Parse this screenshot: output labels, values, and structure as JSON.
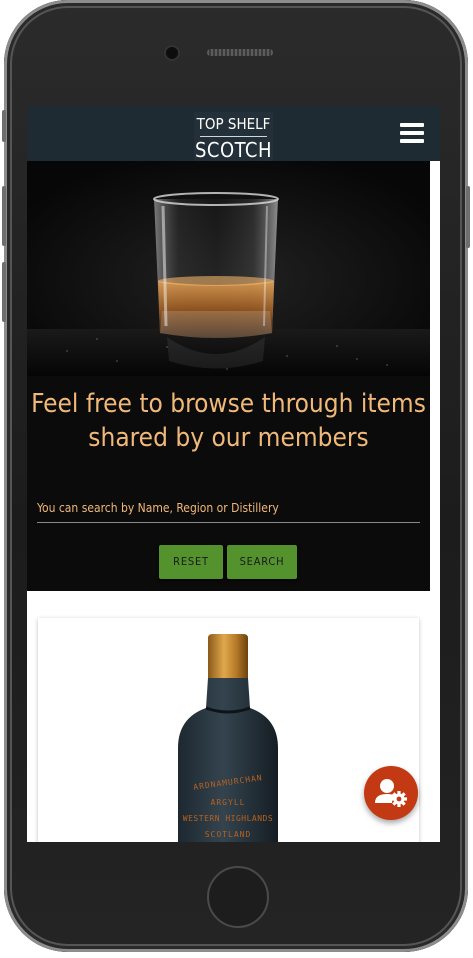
{
  "navbar": {
    "logo_line1": "TOP SHELF",
    "logo_line2": "SCOTCH",
    "menu_icon": "hamburger-menu-icon"
  },
  "hero": {
    "title": "Feel free to browse through items shared by our members",
    "image": "whisky-glass-photo"
  },
  "search": {
    "placeholder": "You can search by Name, Region or Distillery",
    "reset_label": "RESET",
    "search_label": "SEARCH"
  },
  "product_card": {
    "image": "whisky-bottle-photo",
    "label_line1": "ARDNAMURCHAN",
    "label_line2": "ARGYLL",
    "label_line3": "WESTERN HIGHLANDS",
    "label_line4": "SCOTLAND"
  },
  "fab": {
    "icon": "user-settings-icon"
  },
  "colors": {
    "navbar_bg": "#1f2b33",
    "hero_bg": "#0b0b0b",
    "accent_text": "#f0b879",
    "button_green": "#53922c",
    "fab_red": "#c23914"
  }
}
